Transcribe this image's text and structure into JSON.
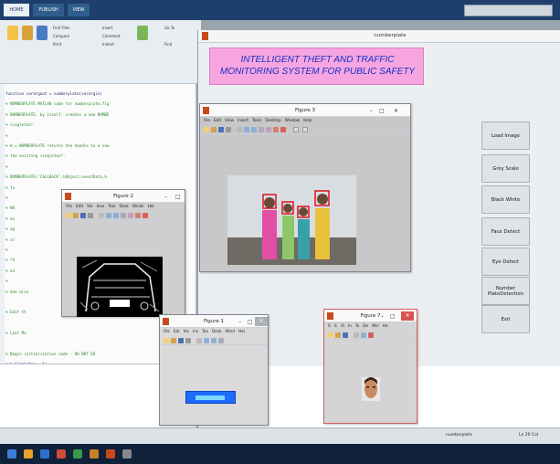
{
  "ribbon": {
    "tabs": [
      "HOME",
      "PUBLISH",
      "VIEW"
    ],
    "new_label": "Find Files",
    "compare_label": "Compare",
    "print_label": "Print",
    "insert_label": "Insert",
    "comment_label": "Comment",
    "indent_label": "Indent",
    "goto_label": "Go To",
    "find_label": "Find"
  },
  "editor": {
    "lines": [
      "function varargout = numberplate(varargin)",
      "% NUMBERPLATE MATLAB code for numberplate.fig",
      "%      NUMBERPLATE, by itself, creates a new NUMBE",
      "%      singleton*.",
      "%",
      "%      H = NUMBERPLATE returns the handle to a new",
      "%      the existing singleton*.",
      "%",
      "%      NUMBERPLATE('CALLBACK',hObject,eventData,h",
      "%      fu",
      "%",
      "%      NU",
      "%      ex",
      "%      ap",
      "%      st",
      "%",
      "%      *S",
      "%      on",
      "%",
      "% See also",
      "",
      "% Edit th",
      "",
      "% Last Mo",
      "",
      "% Begin initialization code - DO NOT ED",
      "gui_Singleton = 1;",
      "gui_State = struct('gui_Name',       mf",
      "                   'gui_Singleton',  gu",
      "                   'gui_OpeningFcn', @n"
    ]
  },
  "gui": {
    "window_title": "numberplate",
    "header": "INTELLIGENT THEFT AND TRAFFIC  MONITORING SYSTEM FOR PUBLIC SAFETY",
    "buttons": [
      "Load Image",
      "Grey Scale",
      "Black White",
      "Face Detect",
      "Eye Detect",
      "Number PlateDetection",
      "Exit"
    ]
  },
  "figures": {
    "figure3": {
      "title": "Figure 3",
      "menu": [
        "File",
        "Edit",
        "View",
        "Insert",
        "Tools",
        "Desktop",
        "Window",
        "Help"
      ]
    },
    "figure2": {
      "title": "Figure 2",
      "menu": [
        "File",
        "Edit",
        "Vie",
        "Inse",
        "Tool",
        "Desk",
        "Windc",
        "Hel"
      ]
    },
    "figure1": {
      "title": "Figure 1",
      "menu": [
        "File",
        "Edi",
        "Vie",
        "Ins",
        "Too",
        "Desk",
        "Wind",
        "Hel"
      ]
    },
    "figure7": {
      "title": "Figure 7",
      "menu": [
        "Fi",
        "E",
        "Vi",
        "In",
        "To",
        "De",
        "Win",
        "He"
      ]
    }
  },
  "status": {
    "left": "numberplate",
    "right": "Ln  20   Col"
  },
  "colors": {
    "header_bg": "#f6a5e0",
    "header_text": "#1430c8",
    "face_box": "#e0121f",
    "plate_text": "#1e6cff"
  }
}
